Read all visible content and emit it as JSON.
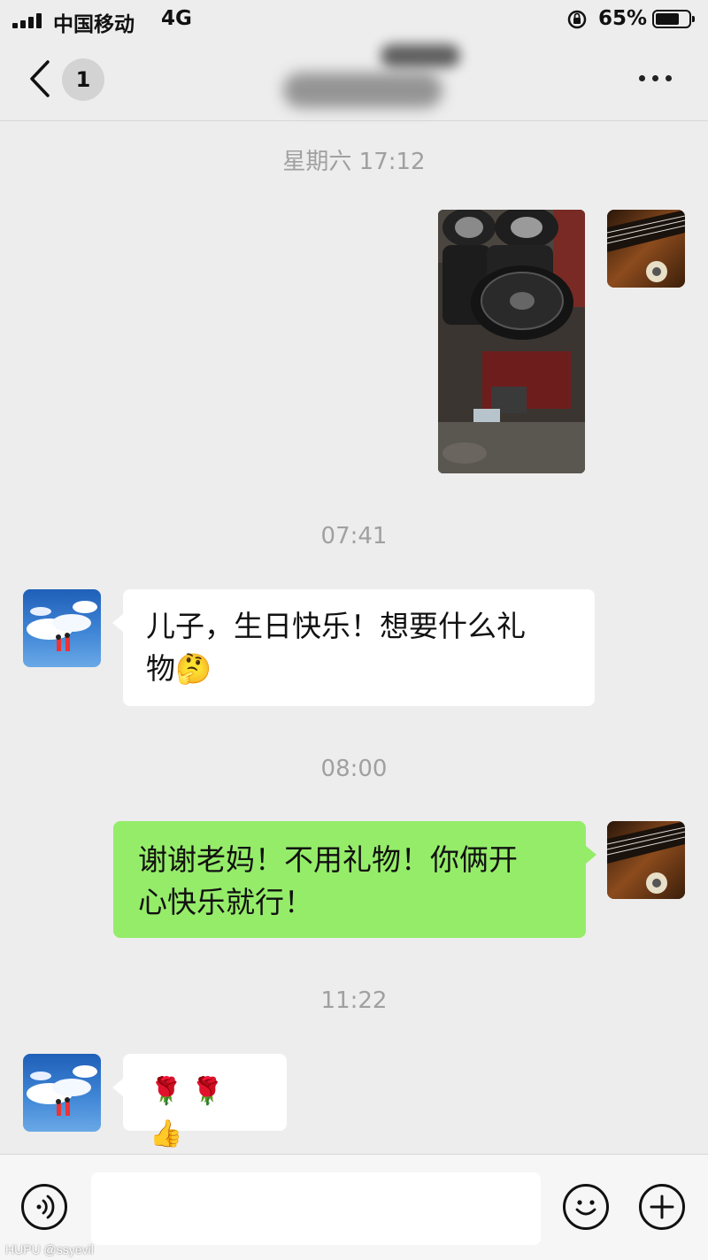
{
  "status_bar": {
    "carrier": "中国移动",
    "network": "4G",
    "battery": "65%"
  },
  "nav": {
    "unread_count": "1"
  },
  "messages": [
    {
      "type": "timestamp",
      "text": "星期六 17:12"
    },
    {
      "type": "image",
      "sender": "me"
    },
    {
      "type": "timestamp",
      "text": "07:41"
    },
    {
      "type": "text",
      "sender": "mom",
      "text_line1": "儿子，生日快乐！想要什么礼",
      "text_line2": "物🤔"
    },
    {
      "type": "timestamp",
      "text": "08:00"
    },
    {
      "type": "text",
      "sender": "me",
      "text_line1": "谢谢老妈！不用礼物！你俩开",
      "text_line2": "心快乐就行！"
    },
    {
      "type": "timestamp",
      "text": "11:22"
    },
    {
      "type": "text",
      "sender": "mom",
      "text": "🌹 🌹 👍"
    }
  ],
  "input_bar": {
    "placeholder": "",
    "icons": [
      "voice-icon",
      "emoji-icon",
      "plus-icon"
    ]
  },
  "watermark": "HUPU @ssyevil",
  "colors": {
    "background": "#ededed",
    "my_bubble": "#95ec69",
    "their_bubble": "#ffffff",
    "timestamp": "#a0a0a0"
  }
}
